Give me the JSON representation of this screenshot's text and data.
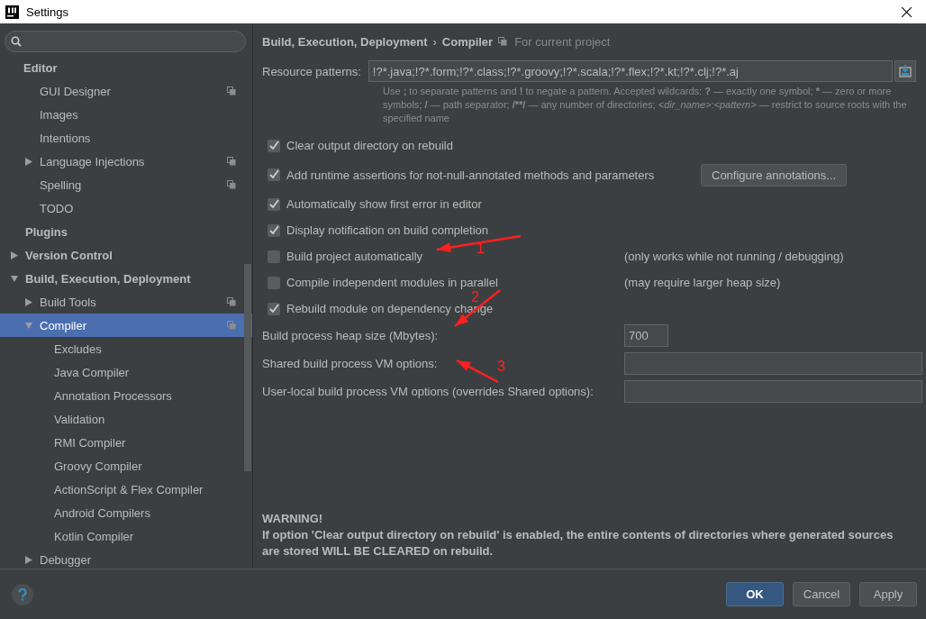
{
  "window": {
    "title": "Settings"
  },
  "sidebar": {
    "items": [
      {
        "label": "Editor",
        "bold": true,
        "selected": false,
        "project_level": false,
        "children": [
          {
            "label": "GUI Designer",
            "selected": false,
            "project_level": true
          },
          {
            "label": "Images",
            "selected": false,
            "project_level": false
          },
          {
            "label": "Intentions",
            "selected": false,
            "project_level": false
          },
          {
            "label": "Language Injections",
            "expanded": false,
            "selected": false,
            "project_level": true
          },
          {
            "label": "Spelling",
            "selected": false,
            "project_level": true
          },
          {
            "label": "TODO",
            "selected": false,
            "project_level": false
          }
        ]
      },
      {
        "label": "Plugins",
        "bold": true,
        "selected": false,
        "project_level": false
      },
      {
        "label": "Version Control",
        "bold": true,
        "expanded": false,
        "selected": false,
        "project_level": false
      },
      {
        "label": "Build, Execution, Deployment",
        "bold": true,
        "expanded": true,
        "selected": false,
        "project_level": false,
        "children": [
          {
            "label": "Build Tools",
            "expanded": false,
            "selected": false,
            "project_level": true
          },
          {
            "label": "Compiler",
            "expanded": true,
            "selected": true,
            "project_level": true,
            "children": [
              {
                "label": "Excludes",
                "selected": false,
                "project_level": false
              },
              {
                "label": "Java Compiler",
                "selected": false,
                "project_level": false
              },
              {
                "label": "Annotation Processors",
                "selected": false,
                "project_level": false
              },
              {
                "label": "Validation",
                "selected": false,
                "project_level": false
              },
              {
                "label": "RMI Compiler",
                "selected": false,
                "project_level": false
              },
              {
                "label": "Groovy Compiler",
                "selected": false,
                "project_level": false
              },
              {
                "label": "ActionScript & Flex Compiler",
                "selected": false,
                "project_level": false
              },
              {
                "label": "Android Compilers",
                "selected": false,
                "project_level": false
              },
              {
                "label": "Kotlin Compiler",
                "selected": false,
                "project_level": false
              }
            ]
          },
          {
            "label": "Debugger",
            "expanded": false,
            "selected": false,
            "project_level": false
          }
        ]
      }
    ]
  },
  "breadcrumb": {
    "parent": "Build, Execution, Deployment",
    "separator": "›",
    "current": "Compiler",
    "scope": "For current project"
  },
  "resource_patterns": {
    "label": "Resource patterns:",
    "value": "!?*.java;!?*.form;!?*.class;!?*.groovy;!?*.scala;!?*.flex;!?*.kt;!?*.clj;!?*.aj",
    "hint": [
      {
        "text": "Use "
      },
      {
        "text": ";",
        "kind": "symbol"
      },
      {
        "text": " to separate patterns and "
      },
      {
        "text": "!",
        "kind": "symbol"
      },
      {
        "text": " to negate a pattern. Accepted wildcards: "
      },
      {
        "text": "?",
        "kind": "symbol"
      },
      {
        "text": " — exactly one symbol; "
      },
      {
        "text": "*",
        "kind": "symbol"
      },
      {
        "text": " — zero or more symbols; "
      },
      {
        "text": "/",
        "kind": "symbol"
      },
      {
        "text": " — path separator; "
      },
      {
        "text": "/**/",
        "kind": "symbol"
      },
      {
        "text": " — any number of directories;  "
      },
      {
        "text": "<dir_name>",
        "kind": "placeholder"
      },
      {
        "text": ":"
      },
      {
        "text": "<pattern>",
        "kind": "placeholder"
      },
      {
        "text": " — restrict to source roots with the specified name"
      }
    ]
  },
  "options": [
    {
      "label": "Clear output directory on rebuild",
      "checked": true
    },
    {
      "label": "Add runtime assertions for not-null-annotated methods and parameters",
      "checked": true,
      "button": "Configure annotations..."
    },
    {
      "label": "Automatically show first error in editor",
      "checked": true
    },
    {
      "label": "Display notification on build completion",
      "checked": true
    },
    {
      "label": "Build project automatically",
      "checked": false,
      "note": "(only works while not running / debugging)"
    },
    {
      "label": "Compile independent modules in parallel",
      "checked": false,
      "note": "(may require larger heap size)"
    },
    {
      "label": "Rebuild module on dependency change",
      "checked": true
    }
  ],
  "fields": [
    {
      "label": "Build process heap size (Mbytes):",
      "value": "700",
      "kind": "short"
    },
    {
      "label": "Shared build process VM options:",
      "kind": "wide"
    },
    {
      "label": "User-local build process VM options (overrides Shared options):",
      "kind": "wide"
    }
  ],
  "warning": {
    "title": "WARNING!",
    "text": "If option 'Clear output directory on rebuild' is enabled, the entire contents of directories where generated sources are stored WILL BE CLEARED on rebuild."
  },
  "buttons": [
    {
      "label": "OK",
      "default": true
    },
    {
      "label": "Cancel",
      "default": false
    },
    {
      "label": "Apply",
      "default": false
    }
  ],
  "annotations": [
    {
      "number": "1"
    },
    {
      "number": "2"
    },
    {
      "number": "3"
    }
  ]
}
